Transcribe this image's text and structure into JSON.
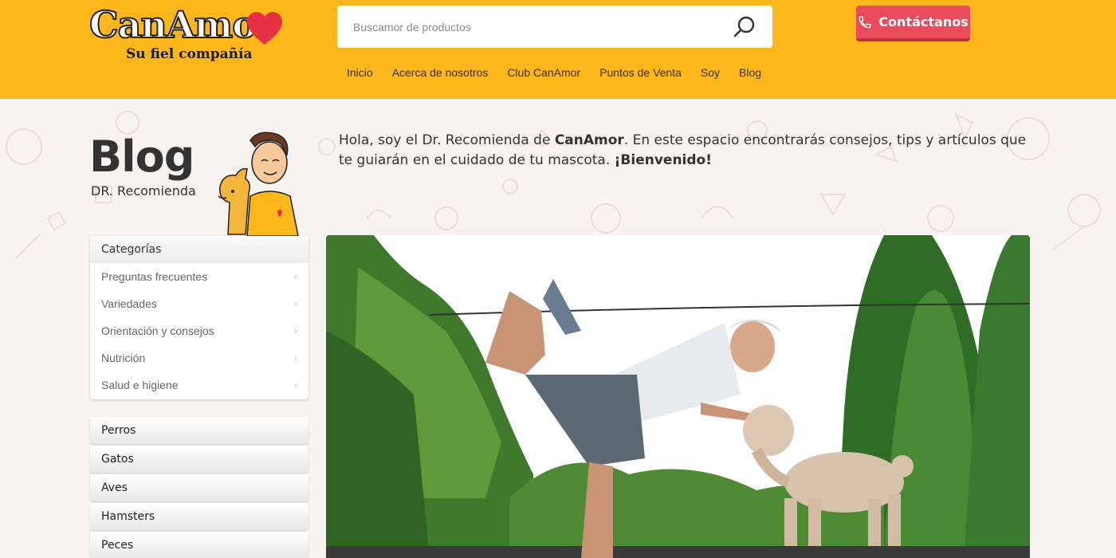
{
  "header": {
    "logo_text": "CanAmor",
    "logo_tagline": "Su fiel compañía",
    "search_placeholder": "Buscamor de productos",
    "contact_label": "Contáctanos",
    "nav": [
      "Inicio",
      "Acerca de nosotros",
      "Club CanAmor",
      "Puntos de Venta",
      "Soy",
      "Blog"
    ]
  },
  "page": {
    "title": "Blog",
    "subtitle": "DR. Recomienda",
    "intro_part1": "Hola, soy el Dr. Recomienda de ",
    "intro_brand": "CanAmor",
    "intro_part2": ". En este espacio encontrarás consejos, tips y artículos que te guiarán en el cuidado de tu mascota. ",
    "intro_welcome": "¡Bienvenido!"
  },
  "sidebar": {
    "categories_title": "Categorías",
    "categories": [
      "Preguntas frecuentes",
      "Variedades",
      "Orientación y consejos",
      "Nutrición",
      "Salud e higiene"
    ],
    "animals": [
      "Perros",
      "Gatos",
      "Aves",
      "Hamsters",
      "Peces"
    ]
  },
  "colors": {
    "header_bg": "#fdb71a",
    "accent_red": "#ea4b5c"
  },
  "icons": {
    "search": "search-icon",
    "phone": "phone-icon",
    "chevron": "chevron-right-icon",
    "heart": "heart-icon"
  }
}
